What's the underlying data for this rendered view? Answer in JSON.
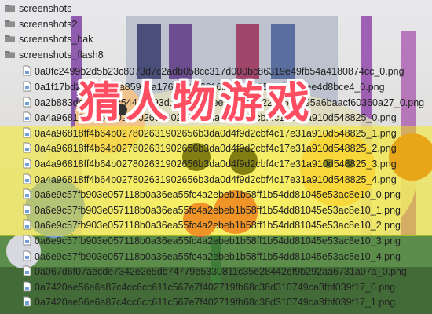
{
  "folders": [
    "screenshots",
    "screenshots2",
    "screenshots_bak",
    "screenshots_flash8"
  ],
  "files": [
    "0a0fc2499b2d5b23c8073d7c2adb058cc317d000bc86319e49fb54a4180874cc_0.png",
    "0a1f17bd27db6d38a8596ca17644c186616b2b5afa85cedb397ee4d8bce4_0.png",
    "0a2b883dec6eba3c54485c93d1a4b36dcee3b38a8b2265571195a6baacf60360a27_0.png",
    "0a4a96818ff4b64b027802631902656b3da0d4f9d2cbf4c17e31a910d548825_0.png",
    "0a4a96818ff4b64b027802631902656b3da0d4f9d2cbf4c17e31a910d548825_1.png",
    "0a4a96818ff4b64b027802631902656b3da0d4f9d2cbf4c17e31a910d548825_2.png",
    "0a4a96818ff4b64b027802631902656b3da0d4f9d2cbf4c17e31a910d548825_3.png",
    "0a4a96818ff4b64b027802631902656b3da0d4f9d2cbf4c17e31a910d548825_4.png",
    "0a6e9c57fb903e057118b0a36ea55fc4a2ebeb1b58ff1b54dd81045e53ac8e10_0.png",
    "0a6e9c57fb903e057118b0a36ea55fc4a2ebeb1b58ff1b54dd81045e53ac8e10_1.png",
    "0a6e9c57fb903e057118b0a36ea55fc4a2ebeb1b58ff1b54dd81045e53ac8e10_2.png",
    "0a6e9c57fb903e057118b0a36ea55fc4a2ebeb1b58ff1b54dd81045e53ac8e10_3.png",
    "0a6e9c57fb903e057118b0a36ea55fc4a2ebeb1b58ff1b54dd81045e53ac8e10_4.png",
    "0a067d6f07aecde7342e2e5db74779e5330811c35e28442ef9b292aa6731a07a_0.png",
    "0a7420ae56e6a87c4cc6cc611c567e7f402719fb68c38d310749ca3fbf039f17_0.png",
    "0a7420ae56e6a87c4cc6cc611c567e7f402719fb68c38d310749ca3fbf039f17_1.png"
  ],
  "overlay_title": "猜人物游戏",
  "colors": {
    "folder": "#7a7a7a",
    "title_red": "#ff4d62",
    "highlight": "#f5ea00"
  }
}
